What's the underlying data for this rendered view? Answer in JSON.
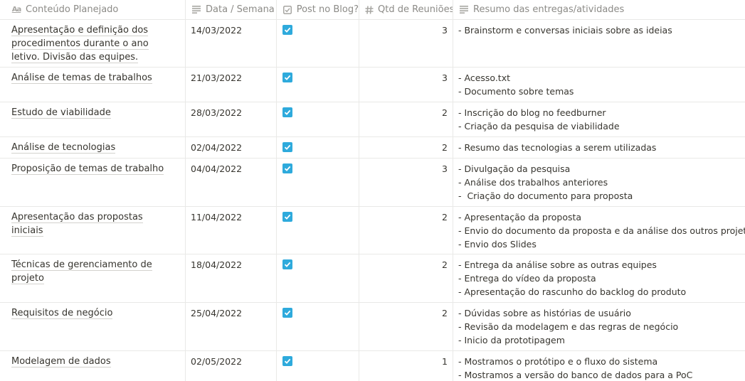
{
  "headers": {
    "title": "Conteúdo Planejado",
    "date": "Data / Semana",
    "blog": "Post no Blog?",
    "qtd": "Qtd de Reuniões",
    "resumo": "Resumo das entregas/atividades"
  },
  "rows": [
    {
      "title": "Apresentação e definição dos procedimentos durante o ano letivo. Divisão das equipes.",
      "date": "14/03/2022",
      "blog": true,
      "qtd": "3",
      "resumo": [
        "- Brainstorm e conversas iniciais sobre as ideias"
      ]
    },
    {
      "title": "Análise de temas de trabalhos",
      "date": "21/03/2022",
      "blog": true,
      "qtd": "3",
      "resumo": [
        "- Acesso.txt",
        "- Documento sobre temas"
      ]
    },
    {
      "title": "Estudo de viabilidade",
      "date": "28/03/2022",
      "blog": true,
      "qtd": "2",
      "resumo": [
        "- Inscrição do blog no feedburner",
        "- Criação da pesquisa de viabilidade"
      ]
    },
    {
      "title": "Análise de tecnologias",
      "date": "02/04/2022",
      "blog": true,
      "qtd": "2",
      "resumo": [
        "- Resumo das tecnologias a serem utilizadas"
      ]
    },
    {
      "title": "Proposição de temas de trabalho",
      "date": "04/04/2022",
      "blog": true,
      "qtd": "3",
      "resumo": [
        "- Divulgação da pesquisa",
        "- Análise dos trabalhos anteriores",
        "-  Criação do documento para proposta"
      ]
    },
    {
      "title": "Apresentação das propostas iniciais",
      "date": "11/04/2022",
      "blog": true,
      "qtd": "2",
      "resumo": [
        "- Apresentação da proposta",
        "- Envio do documento da proposta e da análise dos outros projetos",
        "- Envio dos Slides"
      ]
    },
    {
      "title": "Técnicas de gerenciamento de projeto",
      "date": "18/04/2022",
      "blog": true,
      "qtd": "2",
      "resumo": [
        "- Entrega da análise sobre as outras equipes",
        "- Entrega do vídeo da proposta",
        "- Apresentação do rascunho do backlog do produto"
      ]
    },
    {
      "title": "Requisitos de negócio",
      "date": "25/04/2022",
      "blog": true,
      "qtd": "2",
      "resumo": [
        "- Dúvidas sobre as histórias de usuário",
        "- Revisão da modelagem e das regras de negócio",
        "- Inicio da prototipagem"
      ]
    },
    {
      "title": "Modelagem de dados",
      "date": "02/05/2022",
      "blog": true,
      "qtd": "1",
      "resumo": [
        "- Mostramos o protótipo e o fluxo do sistema",
        "- Mostramos a versão do banco de dados para a PoC"
      ]
    }
  ],
  "colors": {
    "checkbox": "#2eaadc",
    "border": "#e9e9e7",
    "header_text": "#8c8b87",
    "text": "#37352f"
  },
  "icons": {
    "title": "text-property-icon",
    "date": "text-lines-icon",
    "blog": "checkbox-property-icon",
    "qtd": "number-hash-icon",
    "resumo": "text-lines-icon"
  }
}
